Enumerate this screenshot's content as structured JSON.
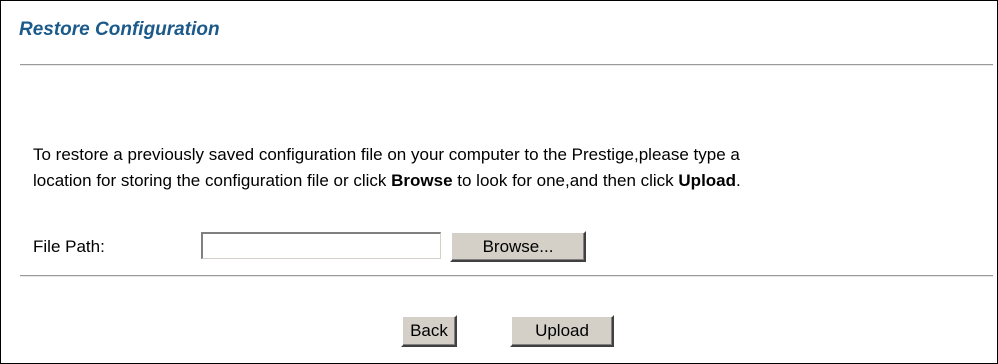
{
  "page": {
    "title": "Restore Configuration"
  },
  "instructions": {
    "line1": "To restore a previously saved configuration file on your computer to the Prestige,please type a",
    "line2_part1": "location for storing the configuration file or click ",
    "line2_browse": "Browse",
    "line2_part2": " to look for one,and then click ",
    "line2_upload": "Upload",
    "line2_end": "."
  },
  "file_path": {
    "label": "File Path:",
    "value": "",
    "browse_label": "Browse..."
  },
  "actions": {
    "back_label": "Back",
    "upload_label": "Upload"
  },
  "colors": {
    "title": "#1b5a8a",
    "button_face": "#d4d0c8",
    "divider": "#9a9a9a"
  }
}
